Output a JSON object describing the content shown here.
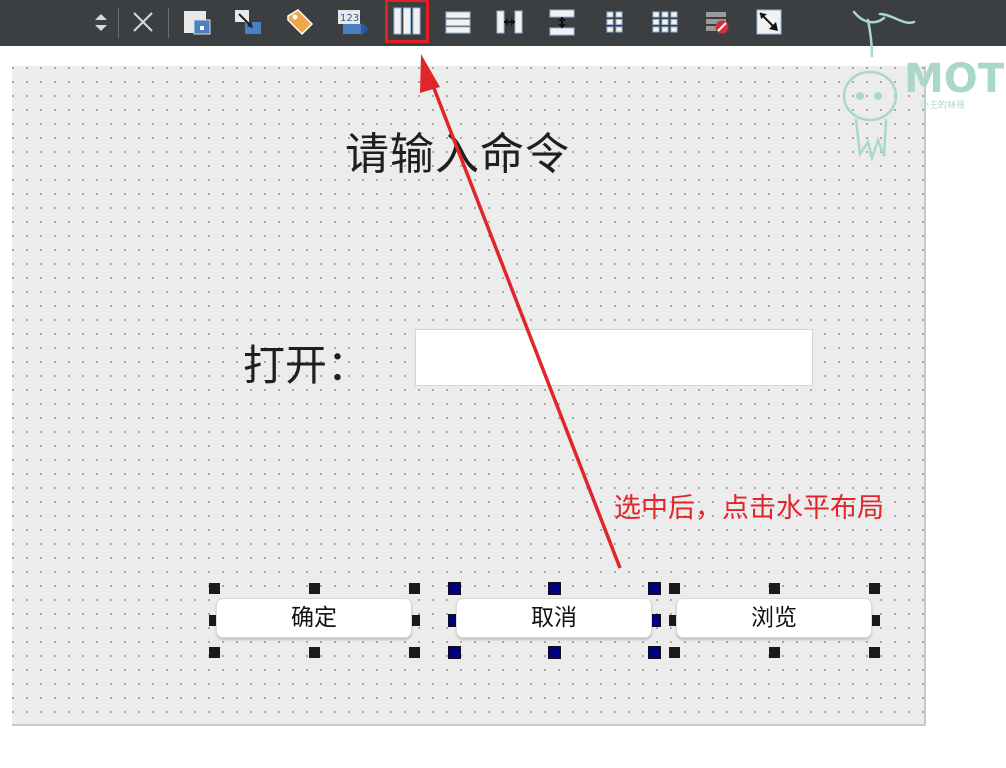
{
  "colors": {
    "toolbar_bg": "#3c3f41",
    "canvas_bg": "#ececec",
    "annotation": "#e0252b",
    "highlight": "#e31e24",
    "watermark": "#a9d8c8"
  },
  "toolbar": {
    "items": [
      {
        "icon": "up-down-arrows-icon"
      },
      {
        "icon": "close-icon"
      },
      {
        "icon": "edit-widgets-icon"
      },
      {
        "icon": "edit-signals-slots-icon"
      },
      {
        "icon": "edit-buddies-icon"
      },
      {
        "icon": "edit-tab-order-icon",
        "text": "123"
      },
      {
        "icon": "layout-horizontally-icon",
        "selected": true
      },
      {
        "icon": "layout-vertically-icon"
      },
      {
        "icon": "layout-horizontal-splitter-icon"
      },
      {
        "icon": "layout-vertical-splitter-icon"
      },
      {
        "icon": "layout-form-icon"
      },
      {
        "icon": "layout-grid-icon"
      },
      {
        "icon": "break-layout-icon"
      },
      {
        "icon": "adjust-size-icon"
      }
    ]
  },
  "form": {
    "title": "请输入命令",
    "open_label": "打开：",
    "open_input_value": "",
    "buttons": {
      "ok": "确定",
      "cancel": "取消",
      "browse": "浏览"
    }
  },
  "annotation": {
    "text": "选中后，点击水平布局"
  },
  "watermark": {
    "logo_text": "MOT",
    "caption": "小王的林哥"
  }
}
